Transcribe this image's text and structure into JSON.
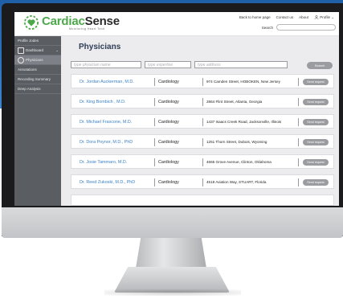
{
  "app": {
    "logo": {
      "brand_part1": "Cardiac",
      "brand_part2": "Sense",
      "tagline": "Monitoring Heart Tech"
    },
    "top_nav": [
      "Back to home page",
      "Contact us",
      "About",
      "Profile"
    ],
    "search_label": "Search"
  },
  "sidebar": {
    "items": [
      {
        "label": "Profile Jodes"
      },
      {
        "label": "Dashboard"
      },
      {
        "label": "Physicians"
      },
      {
        "label": "Annotations"
      },
      {
        "label": "Recording Summary"
      },
      {
        "label": "Deep Analysis"
      }
    ]
  },
  "main": {
    "title": "Physicians",
    "filters": {
      "name_placeholder": "type physician name",
      "expertise_placeholder": "type expertise",
      "address_placeholder": "type address",
      "search_button": "Search"
    },
    "physicians": [
      {
        "name": "Dr. Jordan Auckerman, M.D.",
        "specialty": "Cardiology",
        "address": "974 Camden Street, HOBOKEN, New Jersey",
        "action": "Send request"
      },
      {
        "name": "Dr. King Bombich , M.D.",
        "specialty": "Cardiology",
        "address": "2864 Flint Street, Atlanta, Georgia",
        "action": "Send request"
      },
      {
        "name": "Dr. Michael Frascone,  M.D.",
        "specialty": "Cardiology",
        "address": "1437 Isaacs Creek Road, Jacksonville, Illinois",
        "action": "Send request"
      },
      {
        "name": "Dr. Dora Poynor, M.D., PhD",
        "specialty": "Cardiology",
        "address": "1251 Thorn Street, Dubois, Wyoming",
        "action": "Send request"
      },
      {
        "name": "Dr. Josie Tammaro, M.D.",
        "specialty": "Cardiology",
        "address": "4665 Grove Avenue, Clinton, Oklahoma",
        "action": "Send request"
      },
      {
        "name": "Dr. Reed Zukoski, M.D., PhD",
        "specialty": "Cardiology",
        "address": "4518 Aviation Way, STUART, Florida",
        "action": "Send request"
      }
    ]
  },
  "colors": {
    "background_blue": "#2b73c0",
    "brand_green": "#4da84b",
    "link_blue": "#3b82c7",
    "sidebar_gray": "#5a5e63",
    "button_gray": "#9a9ca0"
  }
}
